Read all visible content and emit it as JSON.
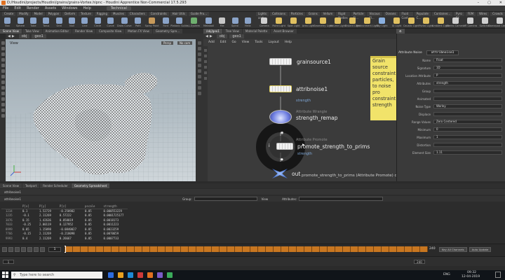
{
  "window": {
    "title": "D:/Houdini/projects/Houdini/grains/grains-Vortex.hipnc - Houdini Apprentice Non-Commercial 17.5.293",
    "controls": [
      "–",
      "▢",
      "✕"
    ]
  },
  "menubar": {
    "items": [
      "File",
      "Edit",
      "Render",
      "Assets",
      "Windows",
      "Help"
    ],
    "desktop": "Technical"
  },
  "shelf": {
    "tabs_left": [
      "Create",
      "Modify",
      "Model",
      "Polygon",
      "Deform",
      "Texture",
      "Rigging",
      "Muscles",
      "Characters",
      "Constraints",
      "Hair Utils",
      "Guide Pro..."
    ],
    "tabs_right": [
      "Lights and...",
      "Collisions",
      "Particles",
      "Grains",
      "Vellum",
      "Rigid Bodies",
      "Particle Fl...",
      "Viscous Fl...",
      "Oceans",
      "Fluid Cont...",
      "Populate C...",
      "Container...",
      "Pyro FX",
      "FEM",
      "Wires",
      "Crowds",
      "Drive Sim..."
    ],
    "tools_left": [
      {
        "label": "Box",
        "color": "#8aa3c8"
      },
      {
        "label": "Sphere",
        "color": "#8aa3c8"
      },
      {
        "label": "Tube",
        "color": "#8aa3c8"
      },
      {
        "label": "Torus",
        "color": "#8aa3c8"
      },
      {
        "label": "Grid",
        "color": "#8aa3c8"
      },
      {
        "label": "Null",
        "color": "#8aa3c8"
      },
      {
        "label": "Line",
        "color": "#8aa3c8"
      },
      {
        "label": "Circle",
        "color": "#8aa3c8"
      },
      {
        "label": "Curve",
        "color": "#8aa3c8"
      },
      {
        "label": "Draw Curve",
        "color": "#8aa3c8"
      },
      {
        "label": "Path",
        "color": "#8aa3c8"
      },
      {
        "label": "Spray Paint",
        "color": "#c89a5a"
      },
      {
        "label": "Font",
        "color": "#8aa3c8"
      },
      {
        "label": "Platonic Solids",
        "color": "#8aa3c8"
      },
      {
        "label": "L-System",
        "color": "#6fb06f"
      },
      {
        "label": "Metaball",
        "color": "#8aa3c8"
      },
      {
        "label": "File",
        "color": "#c8c8c8"
      },
      {
        "label": "Spiral",
        "color": "#8aa3c8"
      },
      {
        "label": "Helix",
        "color": "#8aa3c8"
      }
    ],
    "tools_right": [
      {
        "label": "Camera",
        "color": "#d0d0d0"
      },
      {
        "label": "Point Light",
        "color": "#e0c060"
      },
      {
        "label": "Spot Light",
        "color": "#e0c060"
      },
      {
        "label": "Area Light",
        "color": "#e0c060"
      },
      {
        "label": "Geometry Light",
        "color": "#e0c060"
      },
      {
        "label": "Volume Light",
        "color": "#e0c060"
      },
      {
        "label": "Distant Light",
        "color": "#e0c060"
      },
      {
        "label": "Environment Light",
        "color": "#e0c060"
      },
      {
        "label": "Sky Light",
        "color": "#8ab0e0"
      },
      {
        "label": "GI Light",
        "color": "#e0c060"
      },
      {
        "label": "Caustic Light",
        "color": "#e0c060"
      },
      {
        "label": "Portal Light",
        "color": "#e0c060"
      },
      {
        "label": "Ambient Light",
        "color": "#e0c060"
      },
      {
        "label": "Stereo Camera",
        "color": "#d0d0d0"
      },
      {
        "label": "VR Camera",
        "color": "#d0d0d0"
      },
      {
        "label": "Switcher",
        "color": "#d0d0d0"
      },
      {
        "label": "Gamepad Camera",
        "color": "#d0d0d0"
      }
    ]
  },
  "viewport": {
    "tabs": [
      "Scene View",
      "Take View",
      "Animation Editor",
      "Render View",
      "Composite View",
      "Motion FX View",
      "Geometry Spre..."
    ],
    "path": "obj",
    "node": "geo1",
    "view_label": "View",
    "persp": "Persp",
    "cam": "No cam"
  },
  "network": {
    "tabs": [
      "/obj/geo1",
      "Tree View",
      "Material Palette",
      "Asset Browser"
    ],
    "path": "obj",
    "node": "geo1",
    "menu": [
      "Add",
      "Edit",
      "Go",
      "View",
      "Tools",
      "Layout",
      "Help"
    ],
    "nodes": [
      {
        "name": "grainsource1",
        "type": "",
        "sub": ""
      },
      {
        "name": "attribnoise1",
        "type": "",
        "sub": "strength"
      },
      {
        "name": "strength_remap",
        "type": "Attribute Wrangle",
        "sub": ""
      },
      {
        "name": "promote_strength_to_prims",
        "type": "Attribute Promote",
        "sub": "strength"
      },
      {
        "name": "out",
        "type": "",
        "sub": ""
      }
    ],
    "hover_info": "promote_strength_to_prims (Attribute Promote) c",
    "sticky_text": "Grain source constraint particles, to noise pro constraint strength"
  },
  "params": {
    "node_type": "Attribute Noise",
    "node_name": "attribnoise1",
    "rows": [
      {
        "label": "Name",
        "value": "Float"
      },
      {
        "label": "Signature",
        "value": "1D"
      },
      {
        "label": "Location Attribute",
        "value": "P"
      },
      {
        "label": "Attributes",
        "value": "strength"
      },
      {
        "label": "Group",
        "value": ""
      },
      {
        "label": "Animated",
        "value": ""
      },
      {
        "label": "Noise Type",
        "value": "Worley"
      },
      {
        "label": "Displace",
        "value": ""
      },
      {
        "label": "Range Values",
        "value": "Zero Centered"
      },
      {
        "label": "Minimum",
        "value": "0"
      },
      {
        "label": "Maximum",
        "value": "1"
      },
      {
        "label": "Distortion",
        "value": ""
      },
      {
        "label": "Element Size",
        "value": "1.11"
      }
    ]
  },
  "sheet": {
    "tabs": [
      "Scene View",
      "Textport",
      "Render Scheduler",
      "Geometry Spreadsheet"
    ],
    "node": "attribnoise1",
    "group_label": "Group:",
    "view_label": "View",
    "attributes_label": "Attributes:",
    "columns": [
      "",
      "P[x]",
      "P[y]",
      "P[z]",
      "pscale",
      "strength"
    ],
    "rows": [
      [
        "1234",
        "0.1",
        "1.52729",
        "-0.258982",
        "0.05",
        "0.000553229"
      ],
      [
        "1235",
        "-0.1",
        "2.11269",
        "0.57222",
        "0.05",
        "0.0001725177"
      ],
      [
        "3876",
        "0.15",
        "1.42636",
        "0.858819",
        "0.05",
        "0.0018173"
      ],
      [
        "7033",
        "-0.25",
        "2.00119",
        "0.127952",
        "0.05",
        "0.0011223"
      ],
      [
        "8999",
        "0.05",
        "1.15098",
        "-0.0840027",
        "0.05",
        "0.0023259"
      ],
      [
        "7766",
        "-0.15",
        "2.11269",
        "-0.218098",
        "0.05",
        "0.0070659"
      ],
      [
        "9993",
        "0.4",
        "2.11269",
        "0.26667",
        "0.05",
        "0.0007733"
      ]
    ]
  },
  "timeline": {
    "current_frame": "1",
    "start": "1",
    "end": "240",
    "end_field": "240",
    "buttons": [
      "Key All Channels",
      "Auto Update"
    ]
  },
  "taskbar": {
    "search_placeholder": "Type here to search",
    "time": "09:32",
    "date": "12-04-2019",
    "lang": "ENG"
  }
}
